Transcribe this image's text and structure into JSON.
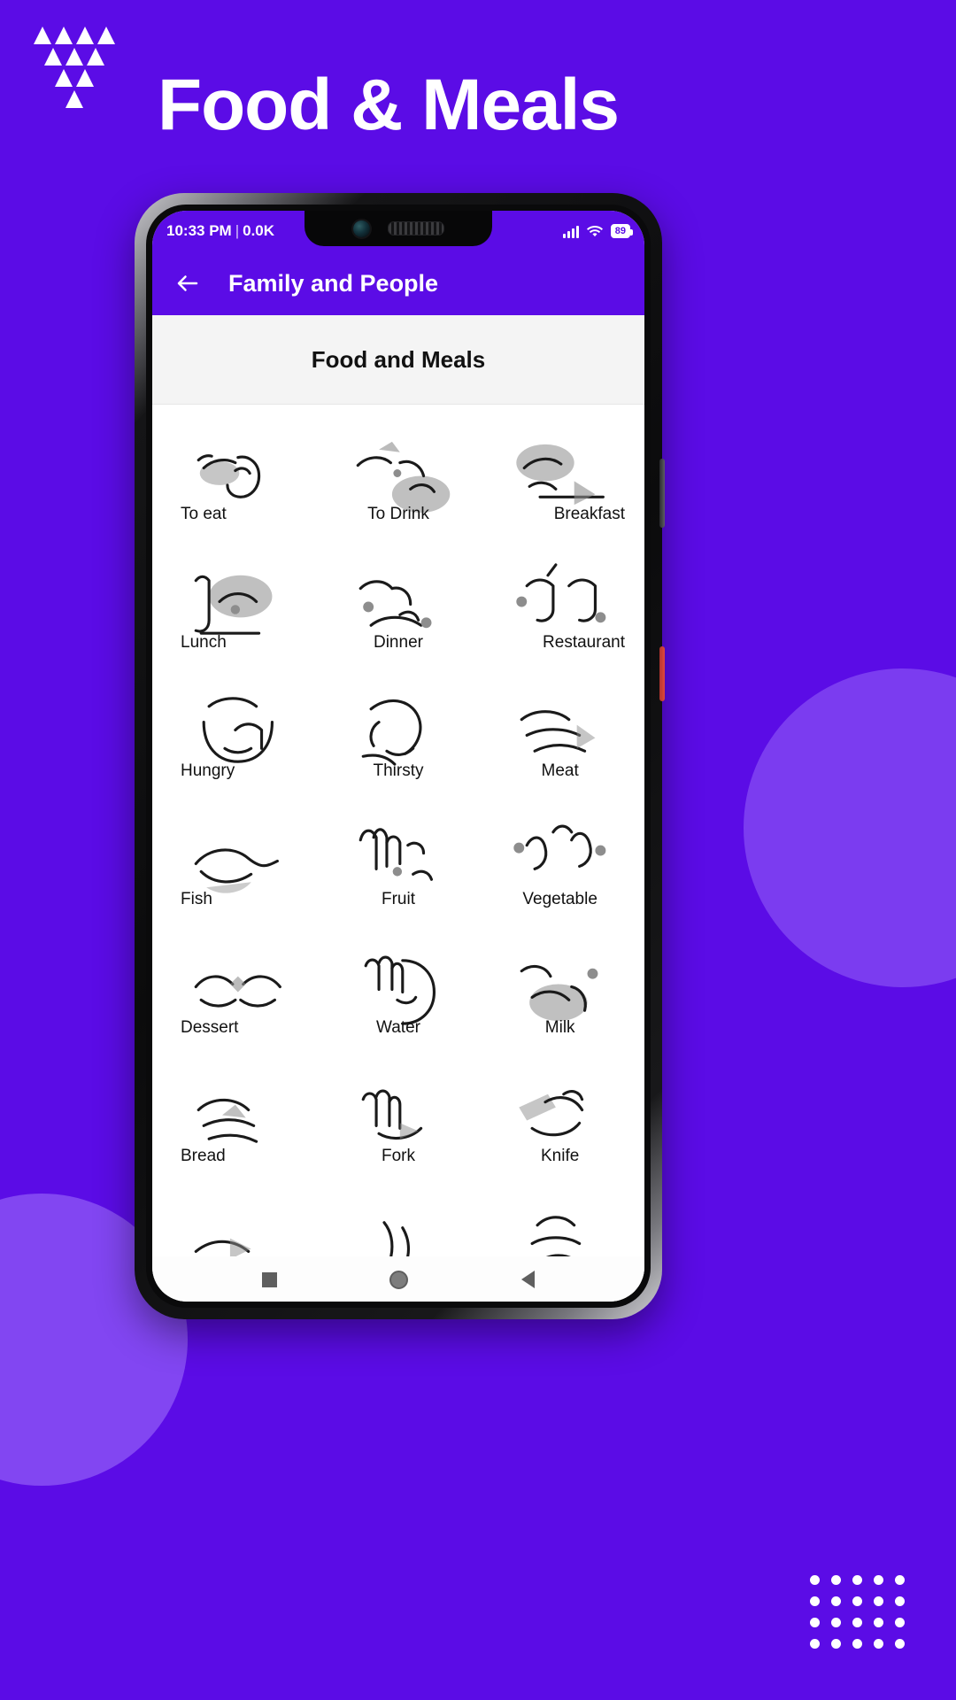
{
  "page": {
    "heading": "Food & Meals",
    "background_color": "#5B0CE6",
    "accent_color": "#5B0CE6"
  },
  "logo": {
    "name": "triangle-cluster-logo",
    "rows": [
      4,
      3,
      2,
      1
    ]
  },
  "phone": {
    "status_bar": {
      "time": "10:33 PM",
      "separator": "|",
      "data_rate": "0.0K",
      "signal_icon": "signal-bars-icon",
      "wifi_icon": "wifi-icon",
      "battery_level": "89"
    },
    "app_bar": {
      "back_icon": "back-arrow-icon",
      "title": "Family and People"
    },
    "section_header": "Food and Meals",
    "nav_bar": {
      "recents": "square-recents-icon",
      "home": "circle-home-icon",
      "back": "triangle-back-icon"
    }
  },
  "grid": {
    "items": [
      {
        "label": "To eat",
        "align": "left"
      },
      {
        "label": "To Drink",
        "align": "mid"
      },
      {
        "label": "Breakfast",
        "align": "right"
      },
      {
        "label": "Lunch",
        "align": "left"
      },
      {
        "label": "Dinner",
        "align": "mid"
      },
      {
        "label": "Restaurant",
        "align": "right"
      },
      {
        "label": "Hungry",
        "align": "left"
      },
      {
        "label": "Thirsty",
        "align": "mid"
      },
      {
        "label": "Meat",
        "align": "mid"
      },
      {
        "label": "Fish",
        "align": "left"
      },
      {
        "label": "Fruit",
        "align": "mid"
      },
      {
        "label": "Vegetable",
        "align": "mid"
      },
      {
        "label": "Dessert",
        "align": "left"
      },
      {
        "label": "Water",
        "align": "mid"
      },
      {
        "label": "Milk",
        "align": "mid"
      },
      {
        "label": "Bread",
        "align": "left"
      },
      {
        "label": "Fork",
        "align": "mid"
      },
      {
        "label": "Knife",
        "align": "mid"
      },
      {
        "label": "",
        "align": "left"
      },
      {
        "label": "",
        "align": "mid"
      },
      {
        "label": "",
        "align": "mid"
      }
    ]
  }
}
